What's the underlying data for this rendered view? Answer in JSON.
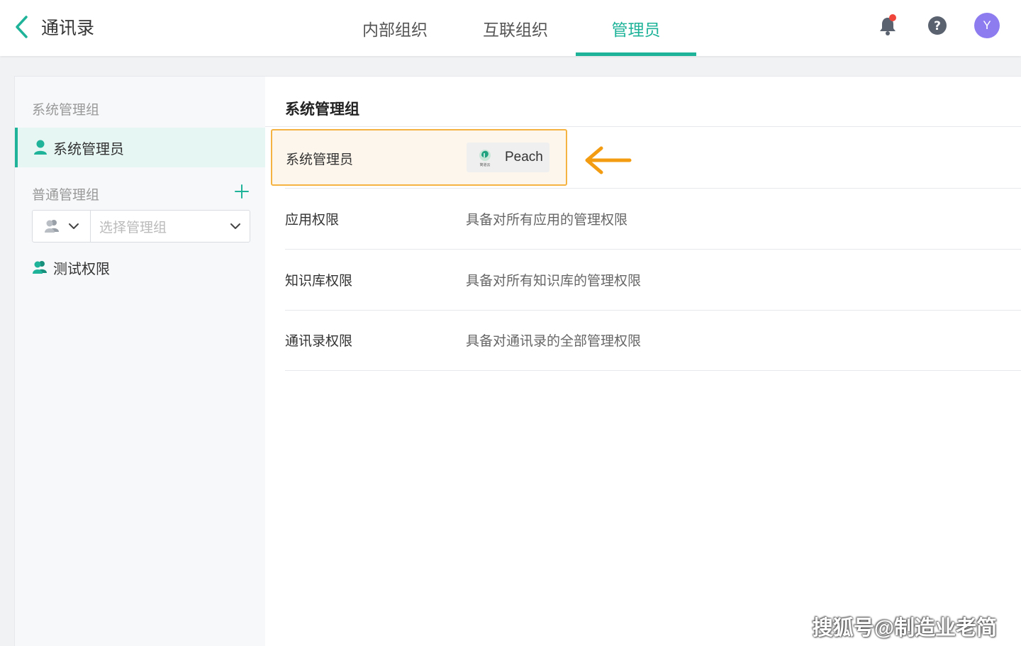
{
  "header": {
    "back_label": "通讯录",
    "tabs": [
      {
        "label": "内部组织"
      },
      {
        "label": "互联组织"
      },
      {
        "label": "管理员"
      }
    ],
    "active_tab": "管理员",
    "avatar_letter": "Y",
    "accent_color": "#1fb39a"
  },
  "sidebar": {
    "system_group_title": "系统管理组",
    "system_admin_item": "系统管理员",
    "normal_group_title": "普通管理组",
    "select_placeholder": "选择管理组",
    "group_items": [
      {
        "label": "测试权限"
      }
    ]
  },
  "main": {
    "title": "系统管理组",
    "admin_row": {
      "label": "系统管理员",
      "member": "Peach",
      "member_logo_text": "简道云"
    },
    "rows": [
      {
        "label": "应用权限",
        "value": "具备对所有应用的管理权限"
      },
      {
        "label": "知识库权限",
        "value": "具备对所有知识库的管理权限"
      },
      {
        "label": "通讯录权限",
        "value": "具备对通讯录的全部管理权限"
      }
    ]
  },
  "watermark": "搜狐号@制造业老简"
}
